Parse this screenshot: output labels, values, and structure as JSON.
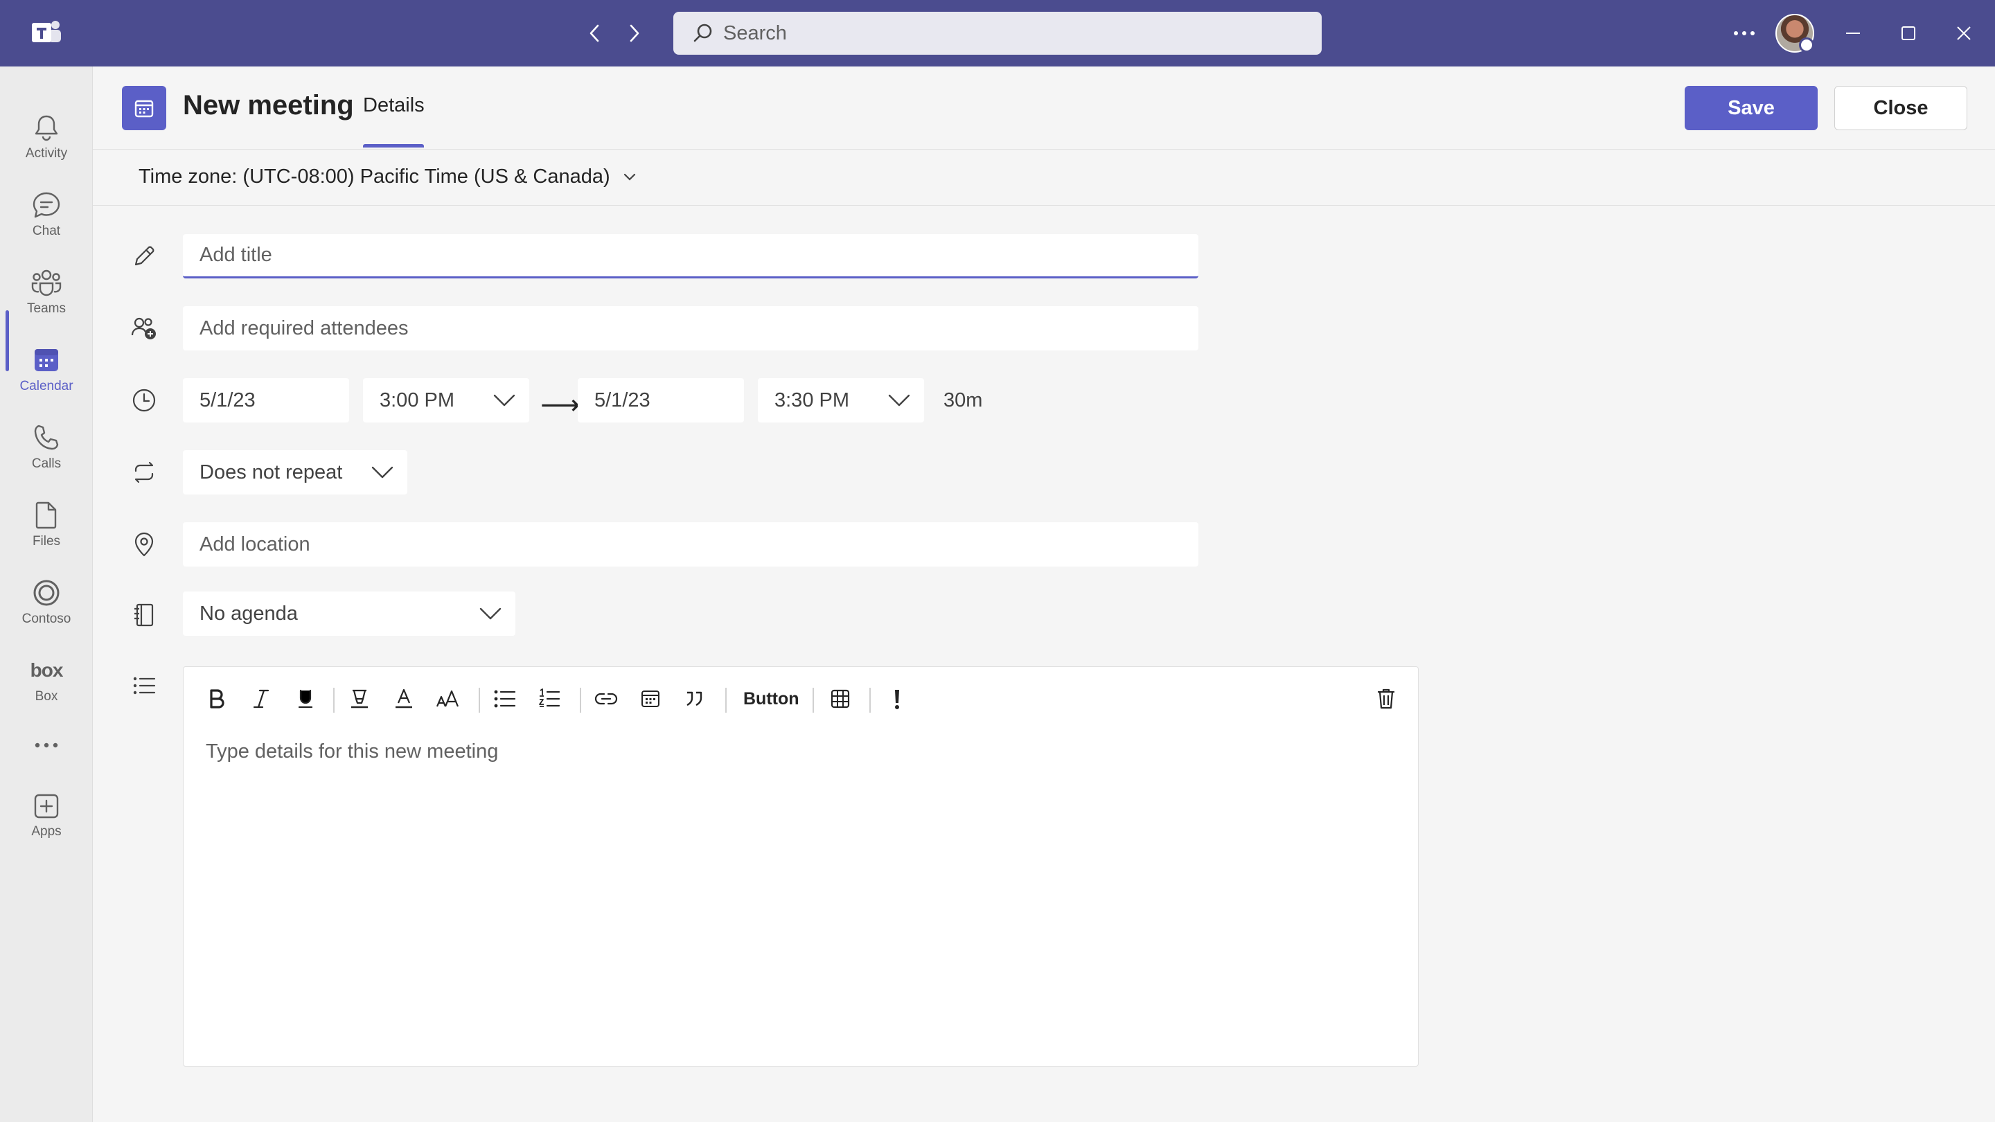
{
  "app": {
    "search_placeholder": "Search"
  },
  "rail": {
    "items": [
      {
        "label": "Activity",
        "icon": "bell-icon"
      },
      {
        "label": "Chat",
        "icon": "chat-icon"
      },
      {
        "label": "Teams",
        "icon": "teams-icon"
      },
      {
        "label": "Calendar",
        "icon": "calendar-icon",
        "active": true
      },
      {
        "label": "Calls",
        "icon": "phone-icon"
      },
      {
        "label": "Files",
        "icon": "file-icon"
      },
      {
        "label": "Contoso",
        "icon": "contoso-icon"
      },
      {
        "label": "Box",
        "icon": "box-icon",
        "logo_text": "box"
      },
      {
        "label": "Apps",
        "icon": "add-apps-icon"
      }
    ]
  },
  "header": {
    "title": "New meeting",
    "tab": "Details",
    "save_label": "Save",
    "close_label": "Close"
  },
  "timezone": {
    "label": "Time zone: (UTC-08:00) Pacific Time (US & Canada)"
  },
  "form": {
    "title_placeholder": "Add title",
    "attendees_placeholder": "Add required attendees",
    "start_date": "5/1/23",
    "start_time": "3:00 PM",
    "arrow": "⟶",
    "end_date": "5/1/23",
    "end_time": "3:30 PM",
    "duration": "30m",
    "repeat": "Does not repeat",
    "location_placeholder": "Add location",
    "agenda": "No agenda"
  },
  "editor": {
    "button_label": "Button",
    "placeholder": "Type details for this new meeting"
  },
  "colors": {
    "titlebar": "#4b4c8f",
    "accent": "#5b5fc7",
    "background": "#f5f5f5"
  }
}
